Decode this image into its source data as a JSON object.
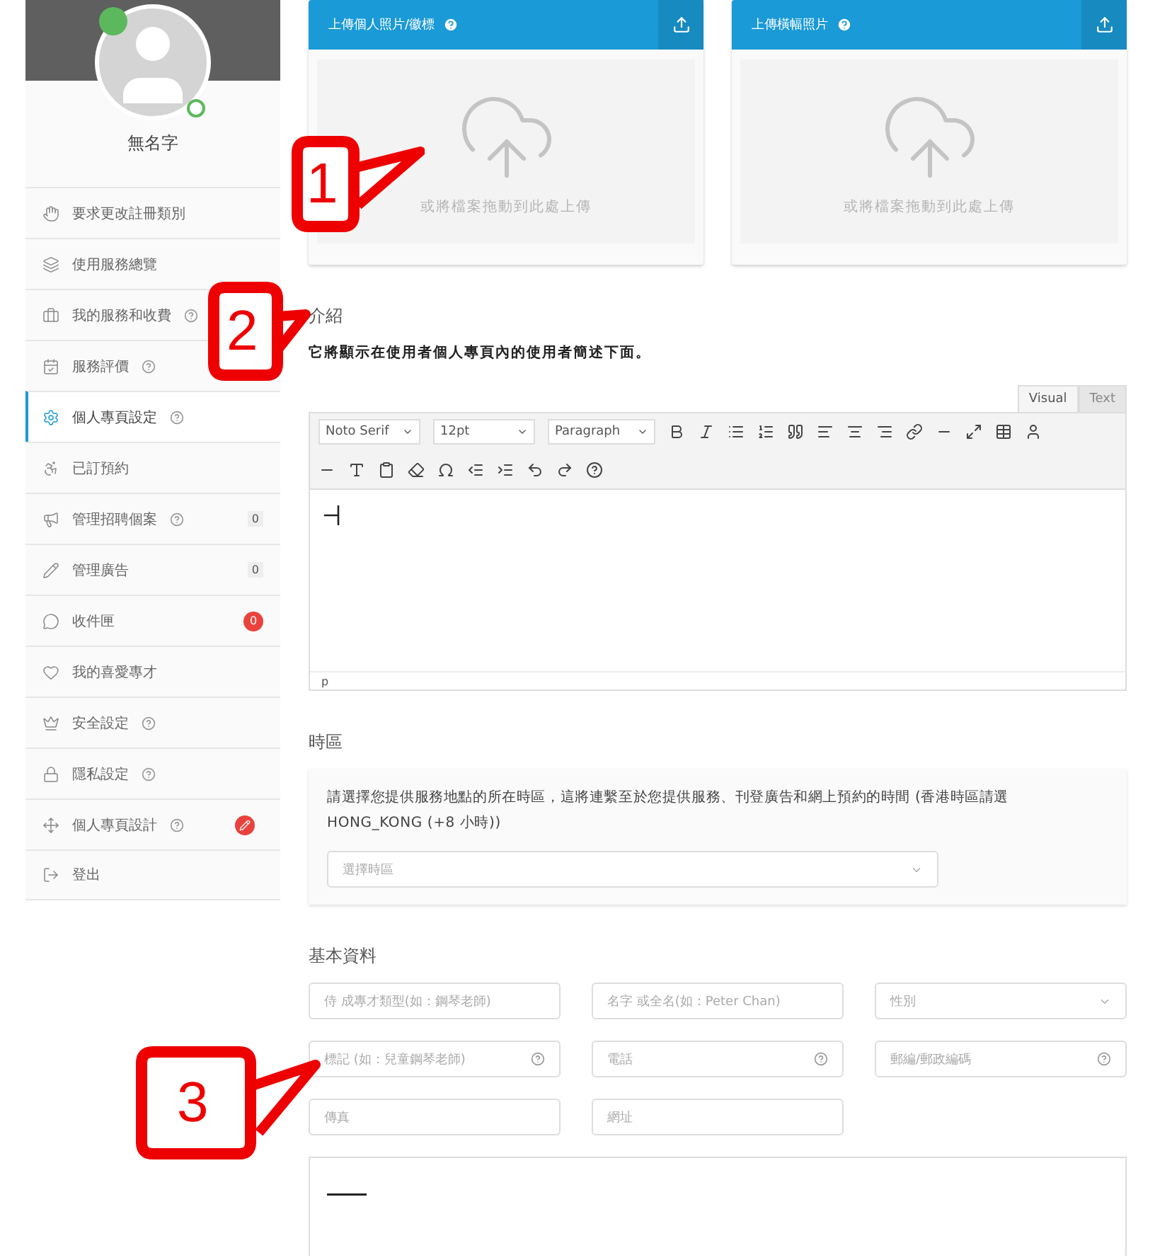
{
  "profile": {
    "name": "無名字",
    "online": true
  },
  "sidebar": {
    "items": [
      {
        "label": "要求更改註冊類別",
        "selected": false,
        "help": false
      },
      {
        "label": "使用服務總覽",
        "selected": false,
        "help": false
      },
      {
        "label": "我的服務和收費",
        "selected": false,
        "help": true
      },
      {
        "label": "服務評價",
        "selected": false,
        "help": true
      },
      {
        "label": "個人專頁設定",
        "selected": true,
        "help": true
      },
      {
        "label": "已訂預約",
        "selected": false,
        "help": false
      },
      {
        "label": "管理招聘個案",
        "selected": false,
        "help": true,
        "badge": {
          "kind": "count",
          "text": "0"
        }
      },
      {
        "label": "管理廣告",
        "selected": false,
        "help": false,
        "badge": {
          "kind": "count",
          "text": "0"
        }
      },
      {
        "label": "收件匣",
        "selected": false,
        "help": false,
        "badge": {
          "kind": "alert",
          "text": "0"
        }
      },
      {
        "label": "我的喜愛專才",
        "selected": false,
        "help": false
      },
      {
        "label": "安全設定",
        "selected": false,
        "help": true
      },
      {
        "label": "隱私設定",
        "selected": false,
        "help": true
      },
      {
        "label": "個人專頁設計",
        "selected": false,
        "help": true,
        "badge": {
          "kind": "edit"
        }
      },
      {
        "label": "登出",
        "selected": false,
        "help": false
      }
    ]
  },
  "uploads": [
    {
      "title": "上傳個人照片/徽標",
      "hint": "或將檔案拖動到此處上傳"
    },
    {
      "title": "上傳橫幅照片",
      "hint": "或將檔案拖動到此處上傳"
    }
  ],
  "intro": {
    "title": "介紹",
    "description": "它將顯示在使用者個人專頁內的使用者簡述下面。",
    "tabs": [
      {
        "label": "Visual",
        "selected": true
      },
      {
        "label": "Text",
        "selected": false
      }
    ],
    "dropdowns": [
      "Noto Serif",
      "12pt",
      "Paragraph"
    ],
    "status": "p"
  },
  "timezone": {
    "title": "時區",
    "description": "請選擇您提供服務地點的所在時區，這將連繫至於您提供服務、刊登廣告和網上預約的時間 (香港時區請選 HONG_KONG (+8 小時))",
    "placeholder": "選擇時區"
  },
  "basic": {
    "title": "基本資料",
    "fields": [
      {
        "kind": "input",
        "placeholder": "侍 成專才類型(如：鋼琴老師)",
        "help": false
      },
      {
        "kind": "input",
        "placeholder": "名字 或全名(如：Peter Chan)",
        "help": false
      },
      {
        "kind": "select",
        "placeholder": "性別",
        "help": false
      },
      {
        "kind": "input",
        "placeholder": "標記 (如：兒童鋼琴老師)",
        "help": true
      },
      {
        "kind": "input",
        "placeholder": "電話",
        "help": true
      },
      {
        "kind": "input",
        "placeholder": "郵編/郵政編碼",
        "help": true
      },
      {
        "kind": "input",
        "placeholder": "傳真",
        "help": false
      },
      {
        "kind": "input",
        "placeholder": "網址",
        "help": false
      }
    ]
  },
  "callouts": [
    {
      "label": "1"
    },
    {
      "label": "2"
    },
    {
      "label": "3"
    }
  ]
}
